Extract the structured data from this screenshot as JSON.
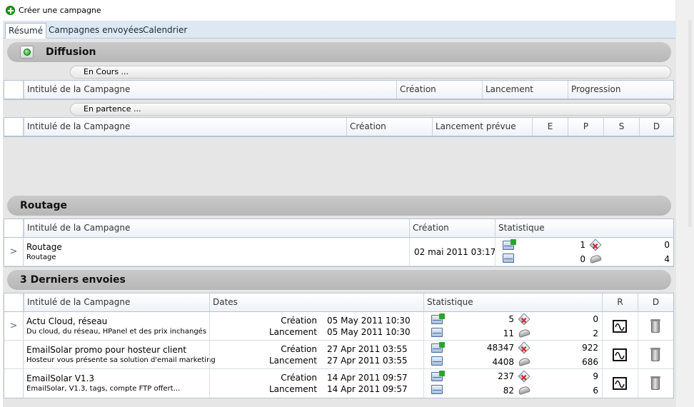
{
  "toolbar": {
    "create_label": "Créer une campagne"
  },
  "tabs": [
    {
      "label": "Résumé"
    },
    {
      "label": "Campagnes envoyées"
    },
    {
      "label": "Calendrier"
    }
  ],
  "diffusion": {
    "title": "Diffusion",
    "en_cours": {
      "label": "En Cours ...",
      "columns": [
        "Intitulé de la Campagne",
        "Création",
        "Lancement",
        "Progression"
      ]
    },
    "en_partence": {
      "label": "En partence ...",
      "columns": [
        "Intitulé de la Campagne",
        "Création",
        "Lancement prévue",
        "E",
        "P",
        "S",
        "D"
      ]
    }
  },
  "routage": {
    "title": "Routage",
    "columns": [
      "Intitulé de la Campagne",
      "Création",
      "Statistique"
    ],
    "rows": [
      {
        "name": "Routage",
        "sub": "Routage",
        "created": "02 mai 2011 03:17",
        "sent": "1",
        "opened": "0",
        "checks": "0",
        "clicks": "4"
      }
    ]
  },
  "derniers": {
    "title": "3 Derniers envoies",
    "columns": [
      "Intitulé de la Campagne",
      "Dates",
      "Statistique",
      "R",
      "D"
    ],
    "created_label": "Création",
    "launch_label": "Lancement",
    "rows": [
      {
        "name": "Actu Cloud, réseau",
        "sub": "Du cloud, du réseau, HPanel et des prix inchangés",
        "created": "05 May 2011 10:30",
        "launched": "05 May 2011 10:30",
        "sent": "5",
        "opened": "11",
        "checks": "0",
        "clicks": "2"
      },
      {
        "name": "EmailSolar promo pour hosteur client",
        "sub": "Hosteur vous présente sa solution d'email marketing",
        "created": "27 Apr 2011 03:55",
        "launched": "27 Apr 2011 03:55",
        "sent": "48347",
        "opened": "4408",
        "checks": "922",
        "clicks": "686"
      },
      {
        "name": "EmailSolar V1.3",
        "sub": "EmailSolar, V1.3, tags, compte FTP offert...",
        "created": "14 Apr 2011 09:57",
        "launched": "14 Apr 2011 09:57",
        "sent": "237",
        "opened": "82",
        "checks": "9",
        "clicks": "6"
      }
    ]
  },
  "icons": {
    "create": "add-icon",
    "diffusion": "status-ok-icon",
    "send": "send-envelope-icon",
    "open": "open-envelope-icon",
    "bounce": "bounce-check-icon",
    "click": "mouse-click-icon",
    "report": "report-icon",
    "delete": "trash-icon"
  }
}
